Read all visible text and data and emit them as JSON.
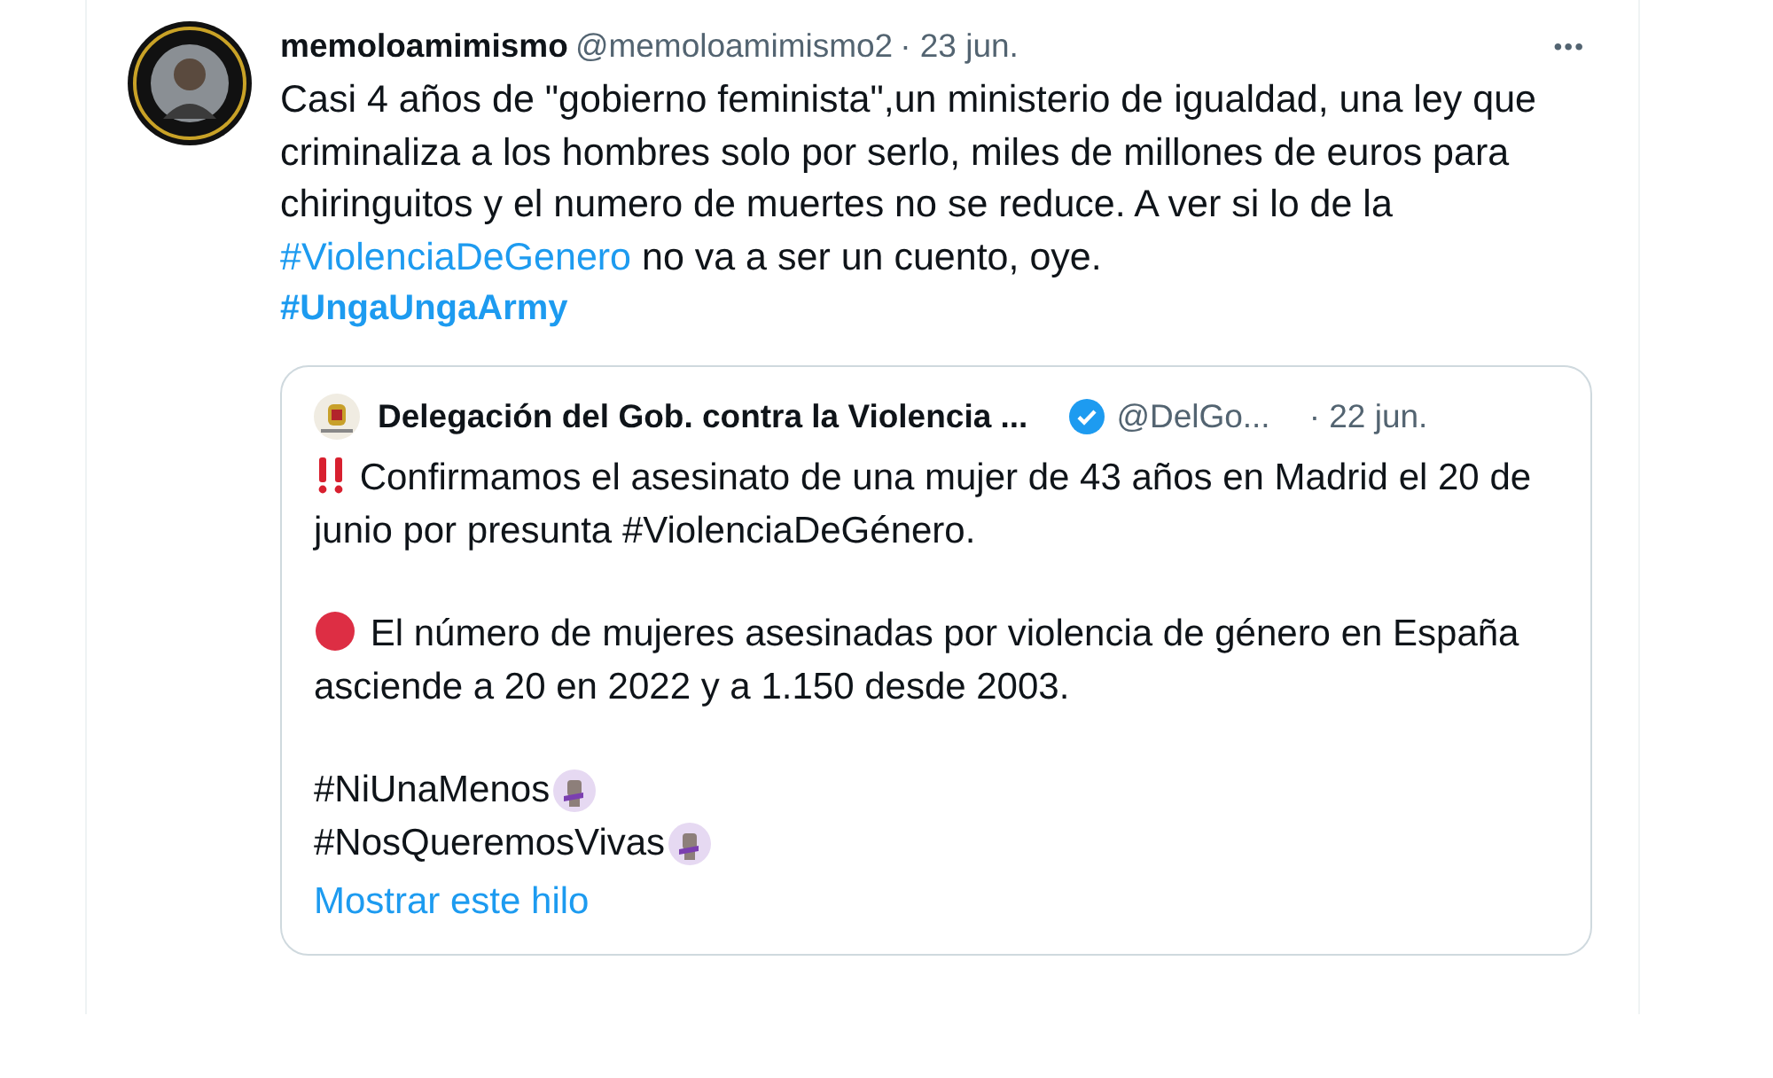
{
  "tweet": {
    "author_name": "memoloamimismo",
    "handle": "@memoloamimismo2",
    "date": "· 23 jun.",
    "more": "•••",
    "body": [
      {
        "kind": "text",
        "text": "Casi 4 años de \"gobierno feminista\",un ministerio de igualdad, una ley que criminaliza a los hombres solo por serlo, miles de millones de euros para chiringuitos y el numero de muertes no se reduce. A ver si lo de la "
      },
      {
        "kind": "hashtag",
        "text": "#ViolenciaDeGenero"
      },
      {
        "kind": "text",
        "text": " no va a ser un cuento, oye."
      }
    ],
    "tag_line": "#UngaUngaArmy"
  },
  "quote": {
    "name": "Delegación del Gob. contra la Violencia ...",
    "verified": true,
    "handle": "@DelGo...",
    "date": "· 22 jun.",
    "paragraphs": [
      {
        "kind": "alert",
        "text": "Confirmamos el asesinato de una mujer de 43 años en Madrid el 20 de junio por presunta #ViolenciaDeGénero."
      },
      {
        "kind": "dot",
        "text": "El número de mujeres asesinadas por violencia de género en España asciende a 20 en 2022 y a 1.150 desde 2003."
      },
      {
        "kind": "tags",
        "lines": [
          "#NiUnaMenos",
          "#NosQueremosVivas"
        ]
      }
    ],
    "thread_link": "Mostrar este hilo"
  }
}
